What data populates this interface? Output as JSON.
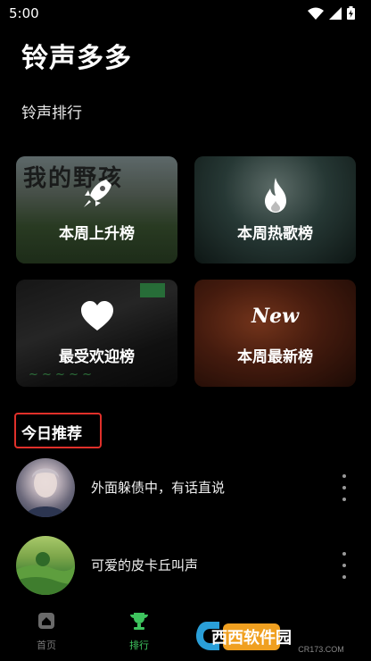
{
  "status": {
    "time": "5:00"
  },
  "app": {
    "title": "铃声多多"
  },
  "rank_section": {
    "title": "铃声排行",
    "cards": [
      {
        "label": "本周上升榜",
        "icon": "rocket-icon"
      },
      {
        "label": "本周热歌榜",
        "icon": "flame-icon"
      },
      {
        "label": "最受欢迎榜",
        "icon": "heart-icon"
      },
      {
        "label": "本周最新榜",
        "icon": "new-badge-icon",
        "badge_text": "New"
      }
    ]
  },
  "recommend": {
    "title": "今日推荐",
    "items": [
      {
        "title": "外面躲债中，有话直说"
      },
      {
        "title": "可爱的皮卡丘叫声"
      }
    ]
  },
  "tabs": [
    {
      "label": "首页",
      "icon": "home-icon",
      "active": false
    },
    {
      "label": "排行",
      "icon": "trophy-icon",
      "active": true
    }
  ],
  "watermark": {
    "brand": "西西软件园",
    "url": "CR173.COM"
  },
  "colors": {
    "accent": "#3ec45e",
    "highlight_border": "#e0302a",
    "background": "#000000"
  }
}
